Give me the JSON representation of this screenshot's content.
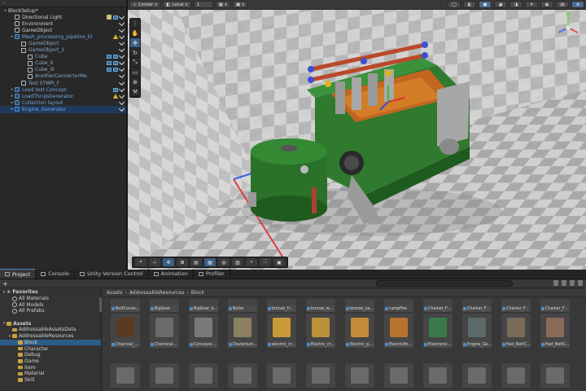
{
  "hierarchy": {
    "rows": [
      {
        "label": "BlockSetup*",
        "indent": 0,
        "kind": "scene",
        "sel": false,
        "icons": []
      },
      {
        "label": "Directional Light",
        "indent": 1,
        "kind": "white",
        "sel": false,
        "icons": [
          "gizmo",
          "ibox",
          "check"
        ]
      },
      {
        "label": "Environment",
        "indent": 1,
        "kind": "white",
        "sel": false,
        "icons": [
          "check"
        ]
      },
      {
        "label": "GameObject",
        "indent": 1,
        "kind": "white",
        "sel": false,
        "icons": [
          "check"
        ]
      },
      {
        "label": "Mesh_processing_pipeline_bl",
        "indent": 1,
        "kind": "blue",
        "sel": false,
        "icons": [
          "warn",
          "check"
        ]
      },
      {
        "label": "GameObject",
        "indent": 2,
        "kind": "dim",
        "sel": false,
        "icons": [
          "check"
        ]
      },
      {
        "label": "GameObject_1",
        "indent": 2,
        "kind": "dim",
        "sel": false,
        "icons": [
          "check"
        ]
      },
      {
        "label": "Cube",
        "indent": 3,
        "kind": "dim",
        "sel": false,
        "icons": [
          "ibox",
          "ibox",
          "check"
        ]
      },
      {
        "label": "Cube_II",
        "indent": 3,
        "kind": "dim",
        "sel": false,
        "icons": [
          "ibox",
          "ibox",
          "check"
        ]
      },
      {
        "label": "Cube_III",
        "indent": 3,
        "kind": "dim",
        "sel": false,
        "icons": [
          "ibox",
          "ibox",
          "check"
        ]
      },
      {
        "label": "AnotherConnectorMe",
        "indent": 3,
        "kind": "dim",
        "sel": false,
        "icons": [
          "check"
        ]
      },
      {
        "label": "Test STMPI_F",
        "indent": 2,
        "kind": "dim",
        "sel": false,
        "icons": [
          "check"
        ]
      },
      {
        "label": "Load test Concept",
        "indent": 1,
        "kind": "blue",
        "sel": false,
        "icons": [
          "ibox",
          "check"
        ]
      },
      {
        "label": "LoadThruJsGenerator",
        "indent": 1,
        "kind": "blue",
        "sel": false,
        "icons": [
          "warn",
          "check"
        ]
      },
      {
        "label": "Collection layout",
        "indent": 1,
        "kind": "blue",
        "sel": false,
        "icons": [
          "check"
        ]
      },
      {
        "label": "Engine_Generator",
        "indent": 1,
        "kind": "blue",
        "sel": true,
        "icons": [
          "check"
        ]
      }
    ]
  },
  "scene_toolbar": {
    "pivot": "Center",
    "space": "Local",
    "snap": "1"
  },
  "bottom_tabs": [
    "Project",
    "Console",
    "Unity Version Control",
    "Animation",
    "Profiler"
  ],
  "project": {
    "add_label": "+",
    "tree": [
      {
        "label": "Favorites",
        "indent": 0,
        "icon": "star",
        "bold": true,
        "sel": false
      },
      {
        "label": "All Materials",
        "indent": 1,
        "icon": "search",
        "bold": false,
        "sel": false
      },
      {
        "label": "All Models",
        "indent": 1,
        "icon": "search",
        "bold": false,
        "sel": false
      },
      {
        "label": "All Prefabs",
        "indent": 1,
        "icon": "search",
        "bold": false,
        "sel": false
      },
      {
        "label": "",
        "indent": 0,
        "icon": "none",
        "bold": false,
        "sel": false
      },
      {
        "label": "Assets",
        "indent": 0,
        "icon": "folder",
        "bold": true,
        "sel": false
      },
      {
        "label": "AddressableAssetsData",
        "indent": 1,
        "icon": "folder",
        "bold": false,
        "sel": false
      },
      {
        "label": "AddressableResources",
        "indent": 1,
        "icon": "folder",
        "bold": false,
        "sel": false
      },
      {
        "label": "Block",
        "indent": 2,
        "icon": "folder",
        "bold": false,
        "sel": true
      },
      {
        "label": "Character",
        "indent": 2,
        "icon": "folder",
        "bold": false,
        "sel": false
      },
      {
        "label": "Debug",
        "indent": 2,
        "icon": "folder",
        "bold": false,
        "sel": false
      },
      {
        "label": "Game",
        "indent": 2,
        "icon": "folder",
        "bold": false,
        "sel": false
      },
      {
        "label": "Item",
        "indent": 2,
        "icon": "folder",
        "bold": false,
        "sel": false
      },
      {
        "label": "Material",
        "indent": 2,
        "icon": "folder",
        "bold": false,
        "sel": false
      },
      {
        "label": "Skill",
        "indent": 2,
        "icon": "folder",
        "bold": false,
        "sel": false
      }
    ],
    "breadcrumb": [
      "Assets",
      "AddressableResources",
      "Block"
    ],
    "row1": [
      "BeltConve...",
      "BigGear",
      "BigGear_b...",
      "Boiler",
      "bronze_fr...",
      "bronze_w...",
      "bronze_sa...",
      "campFire",
      "Chainer_F...",
      "Chainer_F...",
      "Chainer_F...",
      "Chainer_F..."
    ],
    "row2": [
      "Charcoal_...",
      "Chemical...",
      "Conveyor...",
      "Deuterium...",
      "electric_cr...",
      "Electric_cr...",
      "Electric_p...",
      "ElectricPo...",
      "Electronic...",
      "Engine_Ge...",
      "Fast_BeltC...",
      "Fast_BeltC..."
    ],
    "row2_colors": [
      "#5a3a22",
      "#6a6a6a",
      "#7a7a7a",
      "#8c7f64",
      "#c99a3a",
      "#b9923a",
      "#c48a3a",
      "#b8732e",
      "#3a7a4a",
      "#5a6a6a",
      "#7a6a5a",
      "#8a6a5a"
    ]
  }
}
